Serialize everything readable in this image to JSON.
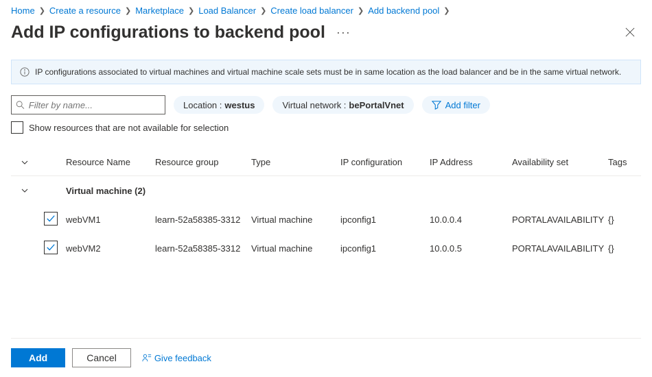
{
  "breadcrumb": [
    "Home",
    "Create a resource",
    "Marketplace",
    "Load Balancer",
    "Create load balancer",
    "Add backend pool"
  ],
  "title": "Add IP configurations to backend pool",
  "info_message": "IP configurations associated to virtual machines and virtual machine scale sets must be in same location as the load balancer and be in the same virtual network.",
  "search_placeholder": "Filter by name...",
  "pills": {
    "location": {
      "label": "Location :",
      "value": "westus"
    },
    "vnet": {
      "label": "Virtual network :",
      "value": "bePortalVnet"
    },
    "add_filter": "Add filter"
  },
  "show_unavailable_label": "Show resources that are not available for selection",
  "columns": {
    "name": "Resource Name",
    "group": "Resource group",
    "type": "Type",
    "ipconfig": "IP configuration",
    "ip": "IP Address",
    "avset": "Availability set",
    "tags": "Tags"
  },
  "group": {
    "label": "Virtual machine (2)"
  },
  "rows": [
    {
      "checked": true,
      "name": "webVM1",
      "group": "learn-52a58385-3312",
      "type": "Virtual machine",
      "ipconfig": "ipconfig1",
      "ip": "10.0.0.4",
      "avset": "PORTALAVAILABILITY",
      "tags": "{}"
    },
    {
      "checked": true,
      "name": "webVM2",
      "group": "learn-52a58385-3312",
      "type": "Virtual machine",
      "ipconfig": "ipconfig1",
      "ip": "10.0.0.5",
      "avset": "PORTALAVAILABILITY",
      "tags": "{}"
    }
  ],
  "footer": {
    "add": "Add",
    "cancel": "Cancel",
    "feedback": "Give feedback"
  }
}
